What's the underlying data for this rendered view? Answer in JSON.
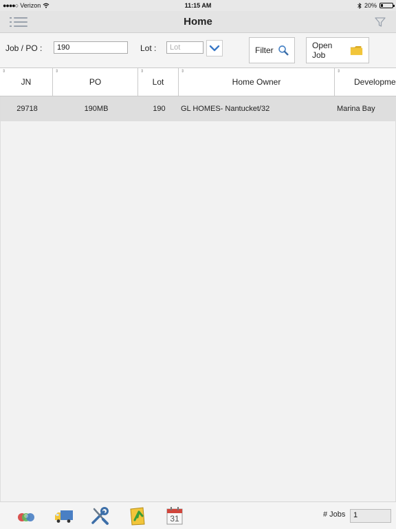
{
  "status_bar": {
    "carrier": "Verizon",
    "signal": "●●●●○",
    "time": "11:15 AM",
    "battery_percent": "20%",
    "battery_level": 0.2
  },
  "nav": {
    "title": "Home"
  },
  "search": {
    "job_po_label": "Job / PO :",
    "job_po_value": "190",
    "lot_label": "Lot :",
    "lot_placeholder": "Lot",
    "filter_label": "Filter",
    "open_job_label": "Open Job"
  },
  "table": {
    "columns": [
      "JN",
      "PO",
      "Lot",
      "Home Owner",
      "Development"
    ],
    "rows": [
      [
        "29718",
        "190MB",
        "190",
        "GL HOMES- Nantucket/32",
        "Marina Bay"
      ]
    ]
  },
  "footer": {
    "jobs_label": "# Jobs",
    "jobs_value": "1",
    "calendar_day": "31"
  },
  "colors": {
    "accent_blue": "#3a78c6",
    "folder_yellow": "#f2c53a",
    "calendar_red": "#d0453b",
    "truck_blue": "#4a7fc4",
    "tools_blue": "#3d6fa8"
  }
}
